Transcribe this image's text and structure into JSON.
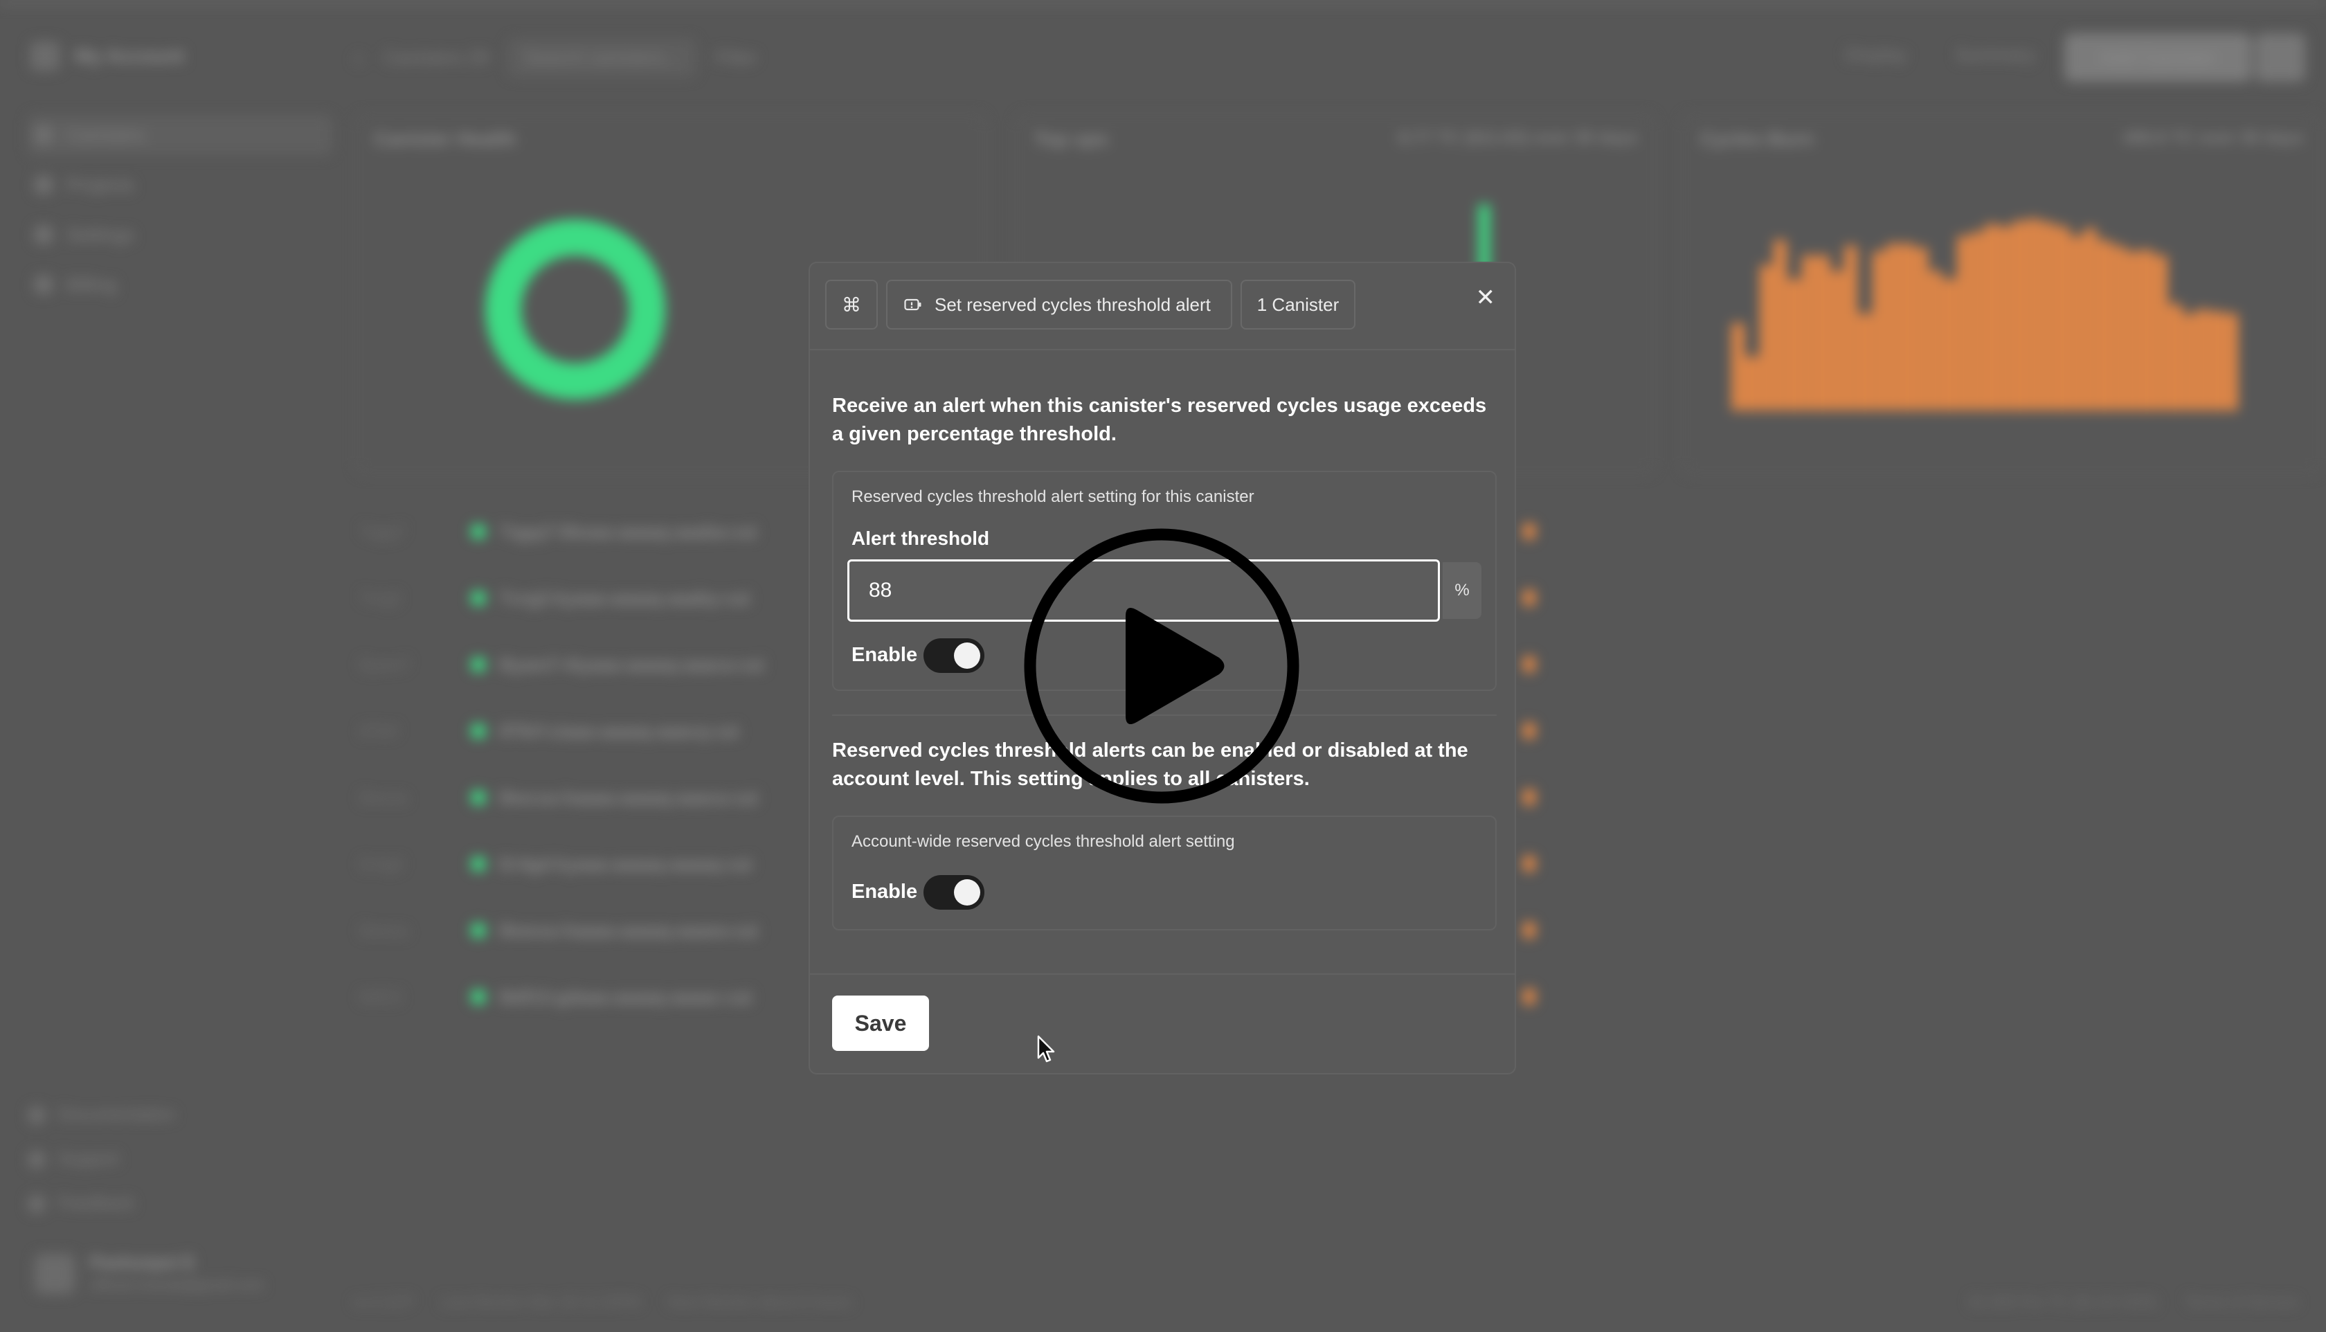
{
  "background": {
    "account_name": "My Account",
    "nav": [
      "Canisters",
      "Projects",
      "Settings",
      "Billing"
    ],
    "bottom_nav": [
      "Documentation",
      "Support",
      "Feedback"
    ],
    "user_name": "Pashunpoi E",
    "user_email": "official.chanda@gmail.com",
    "breadcrumb": "Canisters 29",
    "search_placeholder": "Search canisters...",
    "filter_label": "Filter",
    "display_label": "Display",
    "summary_label": "Summary",
    "add_button": "Add Canister",
    "cards": [
      {
        "title": "Canister Health",
        "stat": ""
      },
      {
        "title": "Top ups",
        "stat": "8.77 TC ($11.63) over 30 days"
      },
      {
        "title": "Cycles Burn",
        "stat": "406.6 TC over 30 days"
      }
    ],
    "rows": [
      {
        "id": "Tqgq7",
        "name": "Tqgq7-5boaa-aaaaq-aaaba-cai"
      },
      {
        "id": "Tvrg2",
        "name": "Tvrg2-kyaaa-aaaaq-aaaby-cai"
      },
      {
        "id": "Byam7",
        "name": "Byam7-4iyaaa-aaaaq-aaaca-cai"
      },
      {
        "id": "8T6rf",
        "name": "8T6rf-ziaaa-aaaaq-aaacq-cai"
      },
      {
        "id": "Bwcxa",
        "name": "Bwcxa-haaaa-aaaaq-aaaca-cai"
      },
      {
        "id": "Er4gd",
        "name": "Er4gd-kyaaa-aaaaq-aaaaq-cai"
      },
      {
        "id": "Bwexa",
        "name": "Bwexa-haaaa-aaaaq-aaaea-cai"
      },
      {
        "id": "Bdf13",
        "name": "Bdf13-gdaaa-aaaaq-aaaac-cai"
      }
    ],
    "status_left": [
      "rs-3.1CP",
      "Last Monitor Mar 18 11:23PM",
      "Next Monitor about 8 hours"
    ],
    "status_right": [
      "$1.665 Per TC ($1.53 XDR)",
      "Terms of Service"
    ],
    "colors": {
      "green": "#3ddc84",
      "orange": "#ef8c45"
    }
  },
  "modal": {
    "cmd_icon": "⌘",
    "action_chip": "Set reserved cycles threshold alert",
    "count_chip": "1 Canister",
    "close_icon": "✕",
    "intro": "Receive an alert when this canister's reserved cycles usage exceeds a given percentage threshold.",
    "canister_setting_label": "Reserved cycles threshold alert setting for this canister",
    "threshold_label": "Alert threshold",
    "threshold_value": "88",
    "threshold_unit": "%",
    "enable_label": "Enable",
    "canister_enabled": true,
    "account_note": "Reserved cycles threshold alerts can be enabled or disabled at the account level. This setting applies to all canisters.",
    "account_setting_label": "Account-wide reserved cycles threshold alert setting",
    "account_enable_label": "Enable",
    "account_enabled": true,
    "save_label": "Save"
  }
}
